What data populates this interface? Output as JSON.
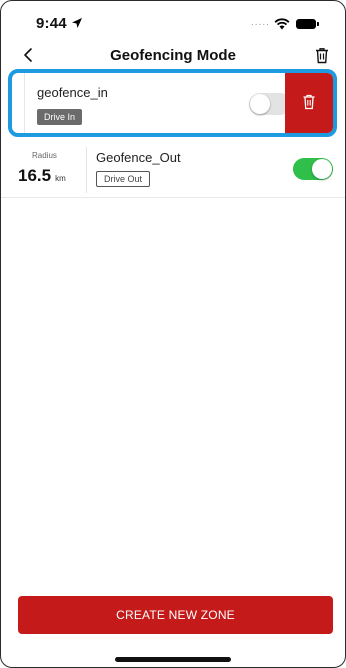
{
  "status_bar": {
    "time": "9:44",
    "dots": "....."
  },
  "header": {
    "title": "Geofencing Mode"
  },
  "zones": [
    {
      "name": "geofence_in",
      "mode": "Drive In",
      "enabled": false
    },
    {
      "name": "Geofence_Out",
      "mode": "Drive Out",
      "enabled": true,
      "radius_label": "Radius",
      "radius_value": "16.5",
      "radius_unit": "km"
    }
  ],
  "footer": {
    "create_label": "CREATE NEW ZONE"
  },
  "colors": {
    "accent": "#c51a1a",
    "highlight": "#1e9be0",
    "toggle_on": "#2fbf4a"
  }
}
